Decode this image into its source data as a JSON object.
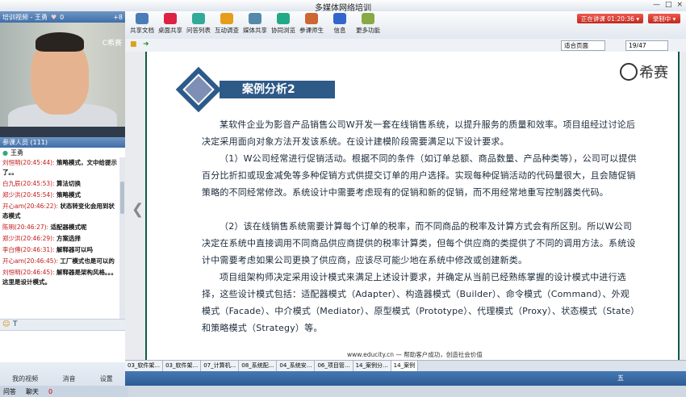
{
  "window": {
    "title": "多媒体网络培训",
    "controls": [
      "—",
      "□",
      "×"
    ]
  },
  "left_panel": {
    "header": {
      "label": "培训视频 - 王勇",
      "count": "0",
      "badge": "+8"
    },
    "video_logo": "C希赛",
    "participants": {
      "header": "参课人员 (111)",
      "me": "王勇"
    },
    "chat": [
      {
        "name": "刘恒明(20:45:44):",
        "text": "策略模式，文中给提示了。。"
      },
      {
        "name": "白九辰(20:45:53):",
        "text": "算法切换"
      },
      {
        "name": "郑少洪(20:45:54):",
        "text": "策略模式"
      },
      {
        "name": "开心am(20:46:22):",
        "text": "状态转变化会用到状态模式"
      },
      {
        "name": "陈明(20:46:27):",
        "text": "适配器模式呢"
      },
      {
        "name": "郑少洪(20:46:29):",
        "text": "方案选择"
      },
      {
        "name": "李白傅(20:46:31):",
        "text": "解释器可以吗"
      },
      {
        "name": "开心am(20:46:45):",
        "text": "工厂模式也是可以的"
      },
      {
        "name": "刘恒明(20:46:45):",
        "text": "解释器是架构风格。。。这里是设计模式。"
      }
    ],
    "footer": {
      "video_btn": "我的视频",
      "mute_btn": "消音",
      "settings_btn": "设置",
      "ask_btn": "问答",
      "chat_btn": "聊天",
      "count": "0"
    }
  },
  "toolbar": {
    "items": [
      "共享文档",
      "桌面共享",
      "问答列表",
      "互动调查",
      "媒体共享",
      "协同浏览",
      "参课师生",
      "信息",
      "更多功能"
    ],
    "live_btn": "正在讲课 01:20:36 ▾",
    "record_btn": "录制中 ▾"
  },
  "viewbar": {
    "zoom": "适合页面",
    "page": "19/47"
  },
  "slide": {
    "heading": "案例分析2",
    "logo_text": "希赛",
    "paragraphs": [
      "某软件企业为影音产品销售公司W开发一套在线销售系统，以提升服务的质量和效率。项目组经过讨论后决定采用面向对象方法开发该系统。在设计建模阶段需要满足以下设计要求。",
      "（1）W公司经常进行促销活动。根据不同的条件（如订单总额、商品数量、产品种类等），公司可以提供百分比折扣或现金减免等多种促销方式供提交订单的用户选择。实现每种促销活动的代码量很大，且会随促销策略的不同经常修改。系统设计中需要考虑现有的促销和新的促销，而不用经常地重写控制器类代码。",
      "（2）该在线销售系统需要计算每个订单的税率，而不同商品的税率及计算方式会有所区别。所以W公司决定在系统中直接调用不同商品供应商提供的税率计算类，但每个供应商的类提供了不同的调用方法。系统设计中需要考虑如果公司更换了供应商，应该尽可能少地在系统中修改或创建新类。",
      "项目组架构师决定采用设计模式来满足上述设计要求，并确定从当前已经熟练掌握的设计模式中进行选择，这些设计模式包括：适配器模式（Adapter）、构造器模式（Builder）、命令模式（Command）、外观模式（Facade）、中介模式（Mediator）、原型模式（Prototype）、代理模式（Proxy）、状态模式（State）和策略模式（Strategy）等。"
    ],
    "footer": "www.educity.cn  — 帮助客户成功，创造社会价值"
  },
  "tabs": [
    "03_软件架...",
    "03_软件架...",
    "07_计算机...",
    "08_系统配...",
    "04_系统安...",
    "06_项目管...",
    "14_案例分...",
    "14_案例"
  ],
  "status": {
    "text": "五",
    "icons": [
      "S",
      "♩",
      "⊞",
      "✎"
    ]
  }
}
